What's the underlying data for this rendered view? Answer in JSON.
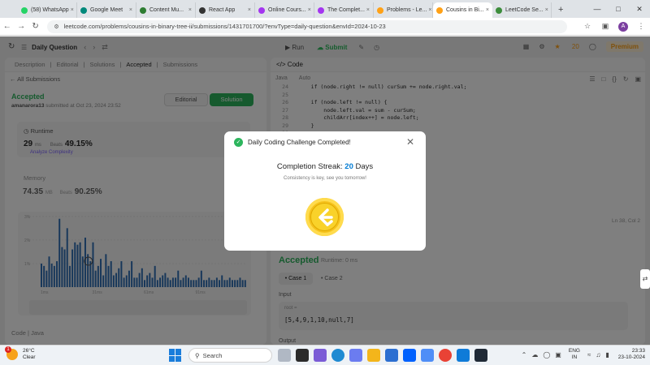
{
  "browser": {
    "tabs": [
      {
        "title": "(58) WhatsApp",
        "color": "#25d366"
      },
      {
        "title": "Google Meet",
        "color": "#00897b"
      },
      {
        "title": "Content Mu...",
        "color": "#2e7d32"
      },
      {
        "title": "React App",
        "color": "#333333"
      },
      {
        "title": "Online Cours...",
        "color": "#a435f0"
      },
      {
        "title": "The Complet...",
        "color": "#a435f0"
      },
      {
        "title": "Problems - Le...",
        "color": "#ffa116"
      },
      {
        "title": "Cousins in Bi...",
        "color": "#ffa116"
      },
      {
        "title": "LeetCode Se...",
        "color": "#3c8d3c"
      }
    ],
    "url": "leetcode.com/problems/cousins-in-binary-tree-ii/submissions/1431701700/?envType=daily-question&envId=2024-10-23",
    "profile_initial": "A"
  },
  "header": {
    "title": "Daily Question",
    "run": "Run",
    "submit": "Submit",
    "streak": "20",
    "premium": "Premium"
  },
  "left": {
    "tabs": [
      "Description",
      "Editorial",
      "Solutions",
      "Accepted",
      "Submissions"
    ],
    "all_submissions": "All Submissions",
    "status": "Accepted",
    "author": "amanarora13",
    "submitted_at": "submitted at Oct 23, 2024 23:52",
    "editorial_btn": "Editorial",
    "solution_btn": "Solution",
    "runtime_label": "Runtime",
    "runtime_value": "29",
    "runtime_unit": "ms",
    "runtime_beats_label": "Beats",
    "runtime_beats": "49.15%",
    "analyze": "Analyze Complexity",
    "memory_label": "Memory",
    "memory_value": "74.35",
    "memory_unit": "MB",
    "memory_beats_label": "Beats",
    "memory_beats": "90.25%",
    "code_label": "Code",
    "code_lang": "Java"
  },
  "chart_data": {
    "type": "bar",
    "x_ticks": [
      "1ms",
      "31ms",
      "61ms",
      "91ms"
    ],
    "y_ticks": [
      "3%",
      "2%",
      "1%"
    ],
    "values": [
      1.0,
      0.9,
      0.7,
      1.3,
      1.0,
      0.9,
      1.1,
      2.9,
      1.7,
      1.6,
      2.5,
      0.9,
      1.6,
      1.9,
      1.8,
      1.9,
      1.3,
      2.1,
      1.4,
      1.1,
      1.9,
      0.7,
      0.9,
      1.2,
      0.5,
      1.4,
      0.9,
      1.1,
      0.5,
      0.6,
      0.8,
      1.1,
      0.4,
      0.5,
      0.7,
      1.1,
      0.4,
      0.4,
      0.6,
      0.8,
      0.3,
      0.5,
      0.6,
      0.4,
      0.9,
      0.3,
      0.4,
      0.5,
      0.6,
      0.4,
      0.3,
      0.4,
      0.4,
      0.7,
      0.3,
      0.4,
      0.5,
      0.4,
      0.3,
      0.3,
      0.3,
      0.4,
      0.7,
      0.3,
      0.3,
      0.4,
      0.3,
      0.3,
      0.4,
      0.3,
      0.5,
      0.3,
      0.3,
      0.4,
      0.3,
      0.3,
      0.3,
      0.4,
      0.3,
      0.3
    ],
    "ylim": [
      0,
      3.2
    ]
  },
  "right": {
    "tab": "Code",
    "lang": "Java",
    "auto": "Auto",
    "code_lines": [
      {
        "n": "24",
        "text": "    if (node.right != null) curSum += node.right.val;"
      },
      {
        "n": "25",
        "text": ""
      },
      {
        "n": "26",
        "text": "    if (node.left != null) {"
      },
      {
        "n": "27",
        "text": "        node.left.val = sum - curSum;"
      },
      {
        "n": "28",
        "text": "        childArr[index++] = node.left;"
      },
      {
        "n": "29",
        "text": "    }"
      },
      {
        "n": "30",
        "text": "                              um;"
      },
      {
        "n": "31",
        "text": "                              ght;"
      },
      {
        "n": "32",
        "text": ""
      },
      {
        "n": "33",
        "text": ""
      },
      {
        "n": "34",
        "text": "                              , index));"
      }
    ],
    "cursor_pos": "Ln 38, Col 2",
    "result_status": "Accepted",
    "result_runtime": "Runtime: 0 ms",
    "case1": "Case 1",
    "case2": "Case 2",
    "input_label": "Input",
    "input_var": "root =",
    "input_value": "[5,4,9,1,10,null,7]",
    "output_label": "Output"
  },
  "modal": {
    "title": "Daily Coding Challenge Completed!",
    "streak_label": "Completion Streak:",
    "streak_num": "20",
    "streak_unit": "Days",
    "message": "Consistency is key, see you tomorrow!"
  },
  "taskbar": {
    "temp": "26°C",
    "weather": "Clear",
    "search": "Search",
    "lang_top": "ENG",
    "lang_bottom": "IN",
    "time": "23:33",
    "date": "23-10-2024",
    "notif_badge": "1"
  }
}
